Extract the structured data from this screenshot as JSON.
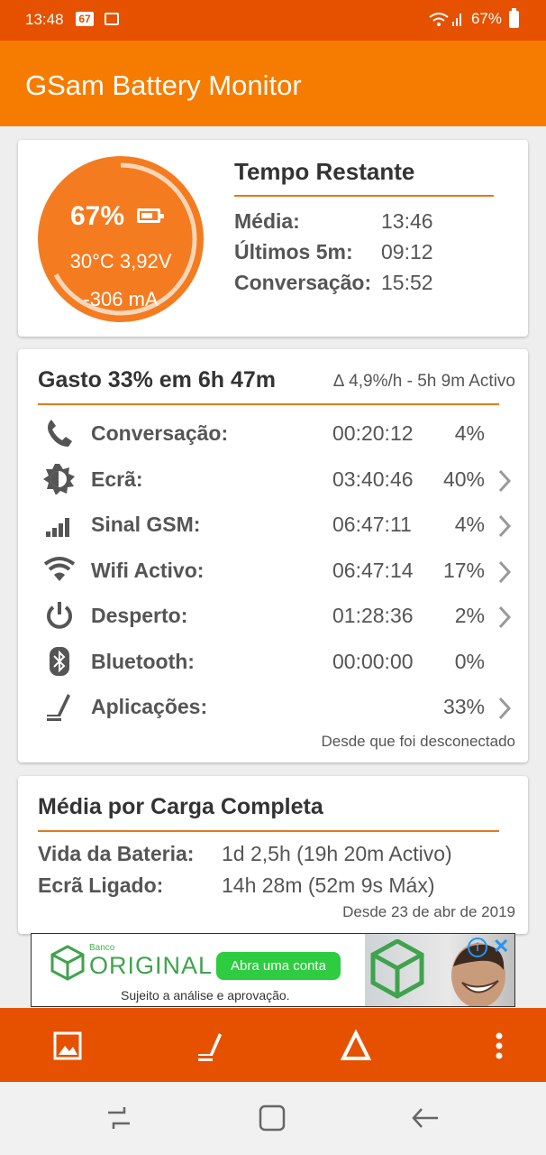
{
  "status_bar": {
    "time": "13:48",
    "badge": "67",
    "battery_text": "67%"
  },
  "app": {
    "title": "GSam Battery Monitor"
  },
  "gauge": {
    "percent_text": "67%",
    "temp_volt": "30°C  3,92V",
    "current": "-306 mA",
    "level": 0.67,
    "color": "#f47b20"
  },
  "remaining": {
    "title": "Tempo Restante",
    "rows": [
      {
        "label": "Média:",
        "value": "13:46"
      },
      {
        "label": "Últimos 5m:",
        "value": "09:12"
      },
      {
        "label": "Conversação:",
        "value": "15:52"
      }
    ]
  },
  "usage": {
    "title": "Gasto 33% em 6h 47m",
    "subtitle": "∆ 4,9%/h - 5h 9m Activo",
    "rows": [
      {
        "icon": "phone-icon",
        "name": "Conversação:",
        "time": "00:20:12",
        "pct": "4%",
        "chevron": false
      },
      {
        "icon": "screen-brightness-icon",
        "name": "Ecrã:",
        "time": "03:40:46",
        "pct": "40%",
        "chevron": true
      },
      {
        "icon": "signal-bars-icon",
        "name": "Sinal GSM:",
        "time": "06:47:11",
        "pct": "4%",
        "chevron": true
      },
      {
        "icon": "wifi-icon",
        "name": "Wifi Activo:",
        "time": "06:47:14",
        "pct": "17%",
        "chevron": true
      },
      {
        "icon": "power-icon",
        "name": "Desperto:",
        "time": "01:28:36",
        "pct": "2%",
        "chevron": true
      },
      {
        "icon": "bluetooth-icon",
        "name": "Bluetooth:",
        "time": "00:00:00",
        "pct": "0%",
        "chevron": false
      },
      {
        "icon": "apps-icon",
        "name": "Aplicações:",
        "time": "",
        "pct": "33%",
        "chevron": true
      }
    ],
    "footer": "Desde que foi desconectado"
  },
  "full_charge": {
    "title": "Média por Carga Completa",
    "rows": [
      {
        "label": "Vida da Bateria:",
        "value": "1d 2,5h (19h 20m Activo)"
      },
      {
        "label": "Ecrã Ligado:",
        "value": "14h 28m (52m 9s Máx)"
      }
    ],
    "footer": "Desde 23 de abr de 2019"
  },
  "ad": {
    "small": "Banco",
    "brand": "ORIGINAL",
    "button": "Abra uma conta",
    "tagline": "Sujeito a análise e aprovação."
  },
  "bottom_bar": {
    "items": [
      "image-icon",
      "apps-icon",
      "delta-icon",
      "more-vert-icon"
    ]
  },
  "colors": {
    "accent": "#f57c00",
    "statusbar": "#e65100",
    "divider": "#e07a1c"
  }
}
